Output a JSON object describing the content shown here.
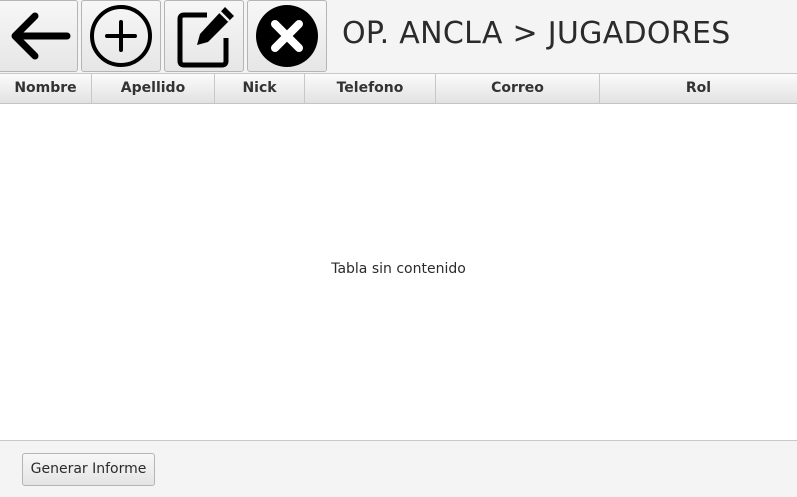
{
  "toolbar": {
    "buttons": [
      {
        "name": "back",
        "icon": "arrow-left-icon"
      },
      {
        "name": "add",
        "icon": "plus-circle-icon"
      },
      {
        "name": "edit",
        "icon": "edit-icon"
      },
      {
        "name": "delete",
        "icon": "x-circle-icon"
      }
    ],
    "title": "OP. ANCLA > JUGADORES"
  },
  "table": {
    "columns": [
      "Nombre",
      "Apellido",
      "Nick",
      "Telefono",
      "Correo",
      "Rol"
    ],
    "rows": [],
    "empty_message": "Tabla sin contenido"
  },
  "footer": {
    "report_button_label": "Generar Informe"
  },
  "colors": {
    "background": "#f4f4f4",
    "table_background": "#ffffff",
    "icon": "#000000"
  }
}
